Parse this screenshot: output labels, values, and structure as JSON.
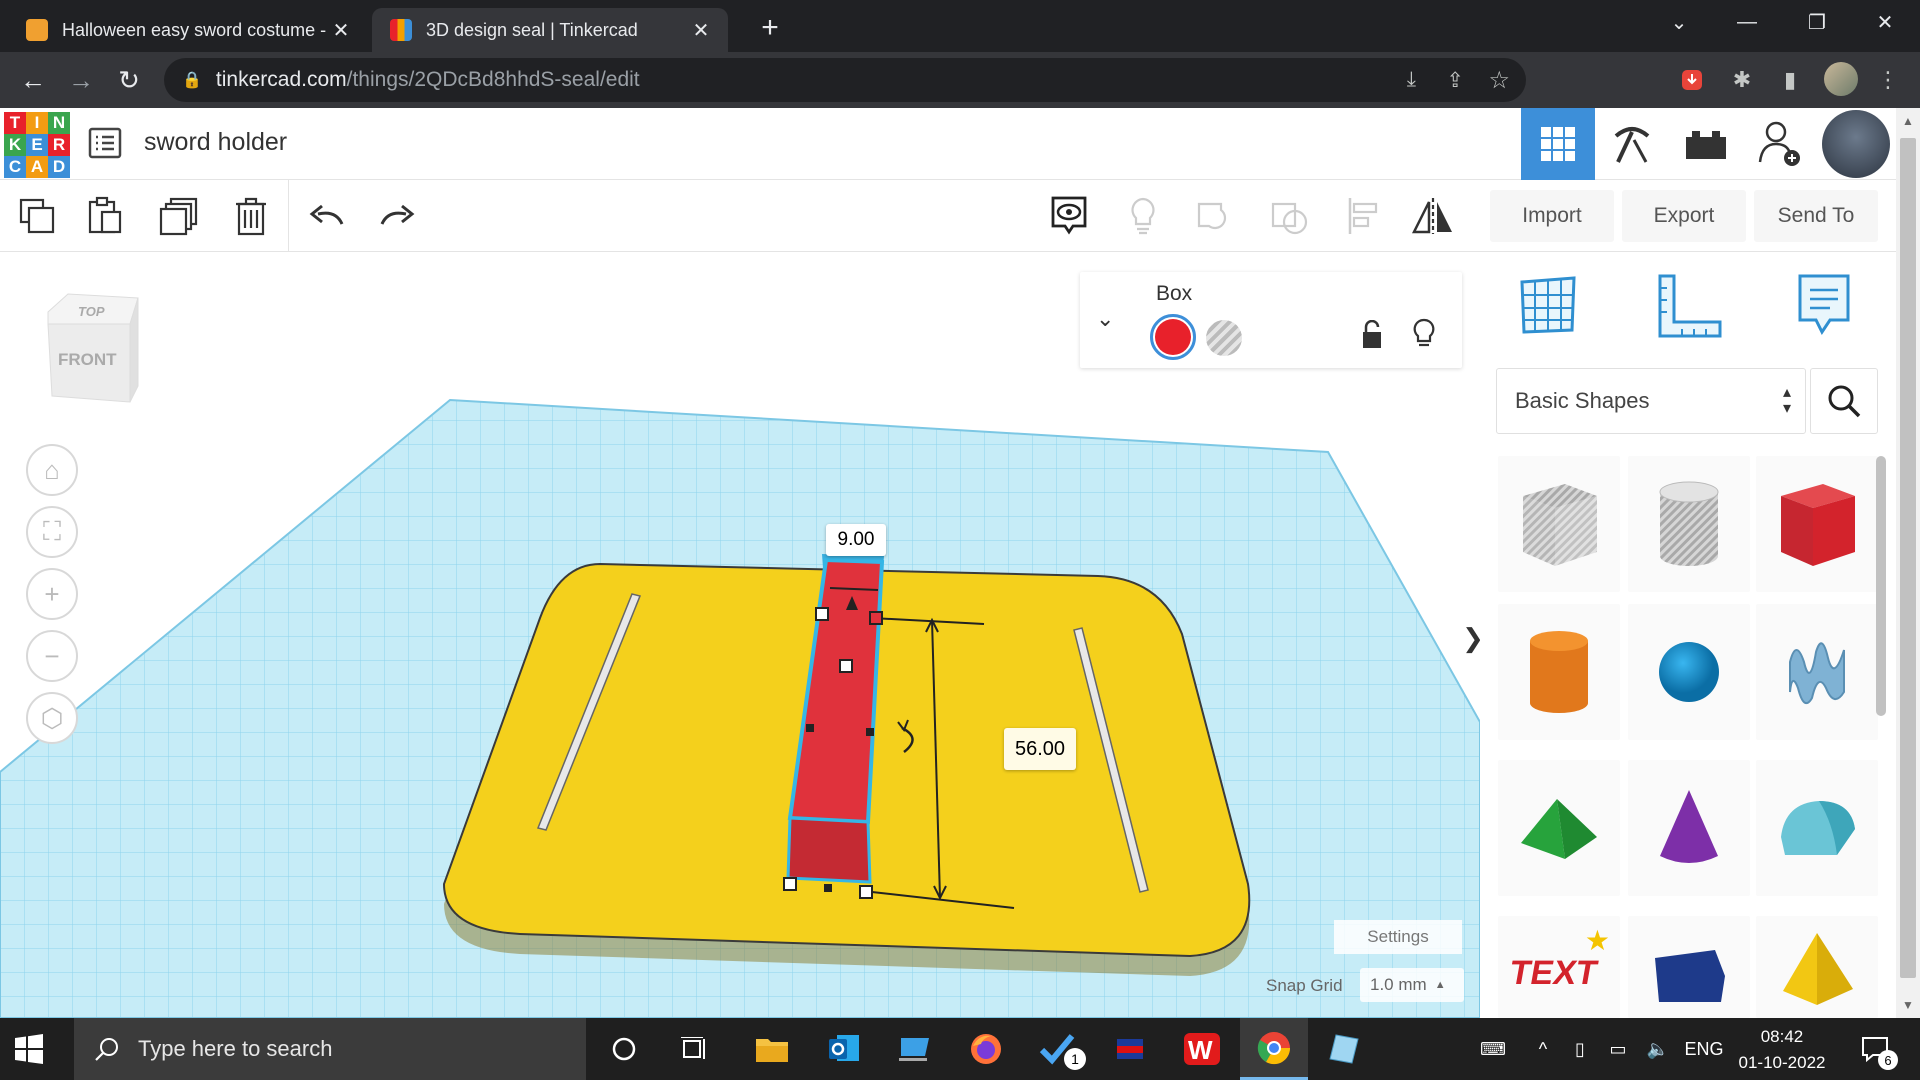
{
  "browser": {
    "tabs": [
      {
        "title": "Halloween easy sword costume -",
        "active": false
      },
      {
        "title": "3D design seal | Tinkercad",
        "active": true
      }
    ],
    "new_tab": "+",
    "url_host": "tinkercad.com",
    "url_path": "/things/2QDcBd8hhdS-seal/edit"
  },
  "tinkercad": {
    "logo_letters": [
      "T",
      "I",
      "N",
      "K",
      "E",
      "R",
      "C",
      "A",
      "D"
    ],
    "design_title": "sword holder",
    "buttons": {
      "import": "Import",
      "export": "Export",
      "send_to": "Send To"
    },
    "view_cube": {
      "top": "TOP",
      "front": "FRONT"
    },
    "inspector": {
      "title": "Box",
      "color_solid": "#e8212b"
    },
    "dimensions": {
      "width": "9.00",
      "length": "56.00"
    },
    "shape_category": "Basic Shapes",
    "settings_label": "Settings",
    "snap_grid_label": "Snap Grid",
    "snap_grid_value": "1.0 mm",
    "collapse_arrow": "❯"
  },
  "colors": {
    "plate": "#f4d01c",
    "box": "#e0323c",
    "grid": "#8fd3ec",
    "accent": "#3d8fd9"
  },
  "taskbar": {
    "search_placeholder": "Type here to search",
    "language": "ENG",
    "time": "08:42",
    "date": "01-10-2022",
    "notification_count": "6",
    "badge_count": "1"
  }
}
